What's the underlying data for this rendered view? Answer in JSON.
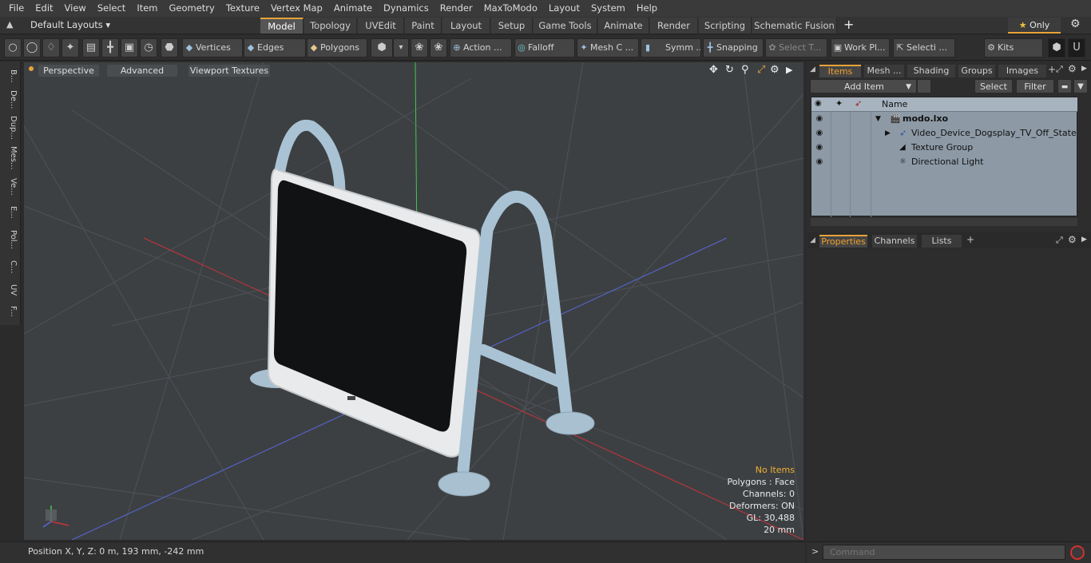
{
  "menu": [
    "File",
    "Edit",
    "View",
    "Select",
    "Item",
    "Geometry",
    "Texture",
    "Vertex Map",
    "Animate",
    "Dynamics",
    "Render",
    "MaxToModo",
    "Layout",
    "System",
    "Help"
  ],
  "layout_selector": "Default Layouts",
  "layout_tabs": [
    "Model",
    "Topology",
    "UVEdit",
    "Paint",
    "Layout",
    "Setup",
    "Game Tools",
    "Animate",
    "Render",
    "Scripting",
    "Schematic Fusion"
  ],
  "active_tab": "Model",
  "only_label": "Only",
  "toolbar": {
    "vertices": "Vertices",
    "edges": "Edges",
    "polygons": "Polygons",
    "action": "Action ...",
    "falloff": "Falloff",
    "mesh": "Mesh C ...",
    "symm": "Symm ...",
    "snapping": "Snapping",
    "select_t": "Select T...",
    "work_pl": "Work Pl...",
    "selecti": "Selecti ...",
    "kits": "Kits"
  },
  "left_strip": [
    "B...",
    "De...",
    "Dup...",
    "Mes...",
    "Ve...",
    "E...",
    "Pol...",
    "C...",
    "UV",
    "F..."
  ],
  "viewport": {
    "perspective": "Perspective",
    "advanced": "Advanced",
    "viewport_textures": "Viewport Textures",
    "hud": {
      "no_items": "No Items",
      "polygons": "Polygons : Face",
      "channels": "Channels: 0",
      "deformers": "Deformers: ON",
      "gl": "GL: 30,488",
      "scale": "20 mm"
    }
  },
  "status_bar": "Position X, Y, Z:  0 m, 193 mm, -242 mm",
  "right_panel": {
    "tabs": [
      "Items",
      "Mesh ...",
      "Shading",
      "Groups",
      "Images"
    ],
    "active_tab": "Items",
    "add_item": "Add Item",
    "select_btn": "Select",
    "filter_btn": "Filter",
    "name_header": "Name",
    "items": [
      {
        "label": "modo.lxo",
        "bold": true
      },
      {
        "label": "Video_Device_Dogsplay_TV_Off_State",
        "bold": false
      },
      {
        "label": "Texture Group",
        "bold": false
      },
      {
        "label": "Directional Light",
        "bold": false
      }
    ],
    "bottom_tabs": [
      "Properties",
      "Channels",
      "Lists"
    ],
    "bottom_active": "Properties"
  },
  "command_placeholder": "Command",
  "colors": {
    "accent": "#e8a33a",
    "items_bg": "#8d9aa6",
    "viewport_bg": "#3d4043"
  }
}
